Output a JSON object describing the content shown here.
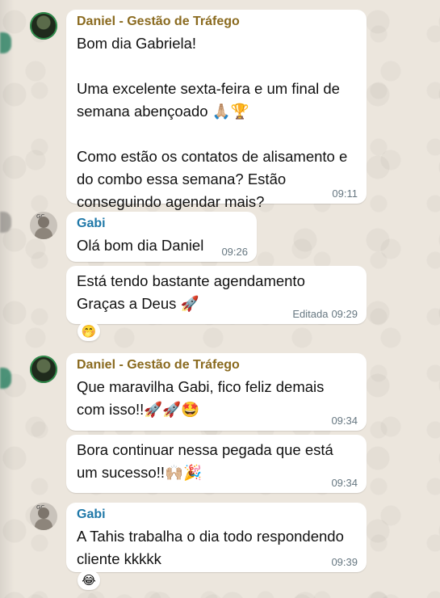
{
  "messages": [
    {
      "sender": "Daniel - Gestão de Tráfego",
      "text": "Bom dia Gabriela!\n\nUma excelente sexta-feira e um final de semana abençoado 🙏🏼🏆\n\nComo estão os contatos de alisamento e do combo essa semana? Estão conseguindo agendar mais?",
      "time": "09:11"
    },
    {
      "sender": "Gabi",
      "text": "Olá bom dia Daniel",
      "time": "09:26"
    },
    {
      "text": "Está tendo bastante agendamento\nGraças a Deus 🚀",
      "edited": "Editada",
      "time": "09:29",
      "reaction": "🤭"
    },
    {
      "sender": "Daniel - Gestão de Tráfego",
      "text": "Que maravilha Gabi, fico feliz demais com isso!!🚀🚀🤩",
      "time": "09:34"
    },
    {
      "text": "Bora continuar nessa pegada que está um sucesso!!🙌🏼🎉",
      "time": "09:34"
    },
    {
      "sender": "Gabi",
      "text": "A Tahis trabalha o dia todo respondendo cliente kkkkk",
      "time": "09:39",
      "reaction": "😂"
    }
  ],
  "avatars": {
    "daniel_icon": "profile-photo-daniel",
    "gabi_icon": "profile-photo-gabi"
  },
  "colors": {
    "bubble": "#ffffff",
    "daniel_name": "#8a6a1f",
    "gabi_name": "#1f78a8",
    "timestamp": "#667781",
    "wallpaper": "#ece6dd"
  }
}
